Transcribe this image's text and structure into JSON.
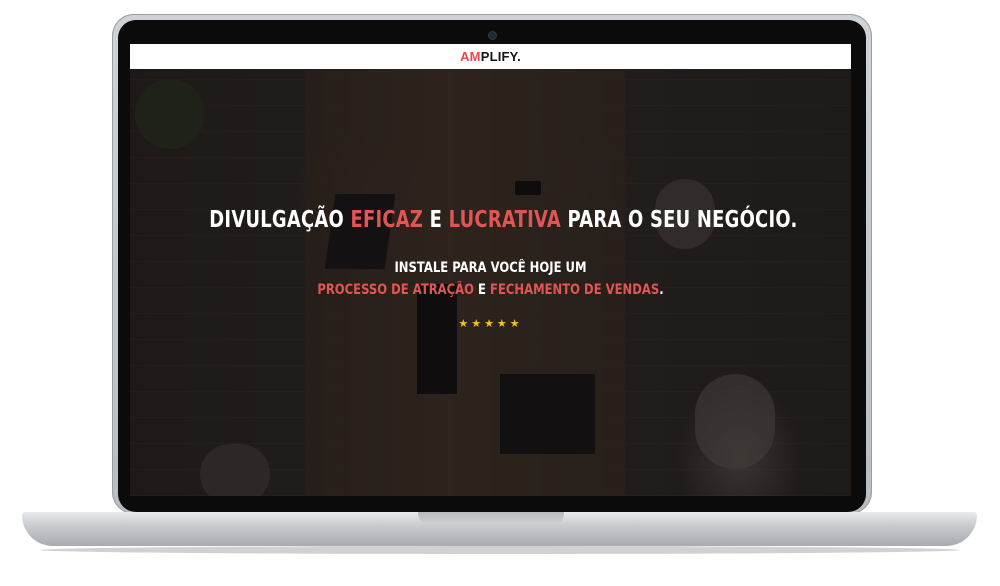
{
  "brand": {
    "accent": "AM",
    "rest": "PLIFY."
  },
  "hero": {
    "headline": {
      "part1": "DIVULGAÇÃO ",
      "highlight1": "EFICAZ",
      "part2": " E ",
      "highlight2": "LUCRATIVA",
      "part3": " PARA O SEU NEGÓCIO."
    },
    "subline1": "INSTALE PARA VOCÊ HOJE UM",
    "subline2": {
      "highlight1": "PROCESSO DE ATRAÇÃO",
      "middle": " E ",
      "highlight2": "FECHAMENTO DE VENDAS",
      "end": "."
    },
    "rating_stars": "★★★★★"
  },
  "colors": {
    "accent_red": "#e25555",
    "star_yellow": "#f2c21b"
  }
}
